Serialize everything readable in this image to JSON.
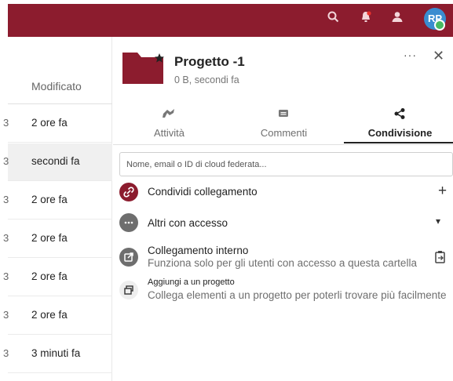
{
  "header": {
    "avatar_initials": "RP",
    "icons": [
      "search-icon",
      "notifications-icon",
      "contacts-icon"
    ],
    "brand_color": "#8c1c2e"
  },
  "file_list": {
    "column_header": "Modificato",
    "rows": [
      {
        "modified": "2 ore fa"
      },
      {
        "modified": "secondi fa"
      },
      {
        "modified": "2 ore fa"
      },
      {
        "modified": "2 ore fa"
      },
      {
        "modified": "2 ore fa"
      },
      {
        "modified": "2 ore fa"
      },
      {
        "modified": "3 minuti fa"
      }
    ],
    "truncated_size_digit": "3"
  },
  "sidebar": {
    "title": "Progetto -1",
    "subtitle": "0 B, secondi fa",
    "more_label": "···",
    "close_label": "✕",
    "tabs": [
      {
        "label": "Attività",
        "icon": "activity-icon"
      },
      {
        "label": "Commenti",
        "icon": "comment-icon"
      },
      {
        "label": "Condivisione",
        "icon": "share-icon"
      }
    ],
    "share_placeholder": "Nome, email o ID di cloud federata...",
    "entries": {
      "share_link": {
        "title": "Condividi collegamento",
        "action": "+"
      },
      "others_access": {
        "title": "Altri con accesso",
        "action": "▾"
      },
      "internal_link": {
        "title": "Collegamento interno",
        "subtitle": "Funziona solo per gli utenti con accesso a questa cartella"
      },
      "add_project": {
        "title": "Aggiungi a un progetto",
        "subtitle": "Collega elementi a un progetto per poterli trovare più facilmente"
      }
    }
  }
}
